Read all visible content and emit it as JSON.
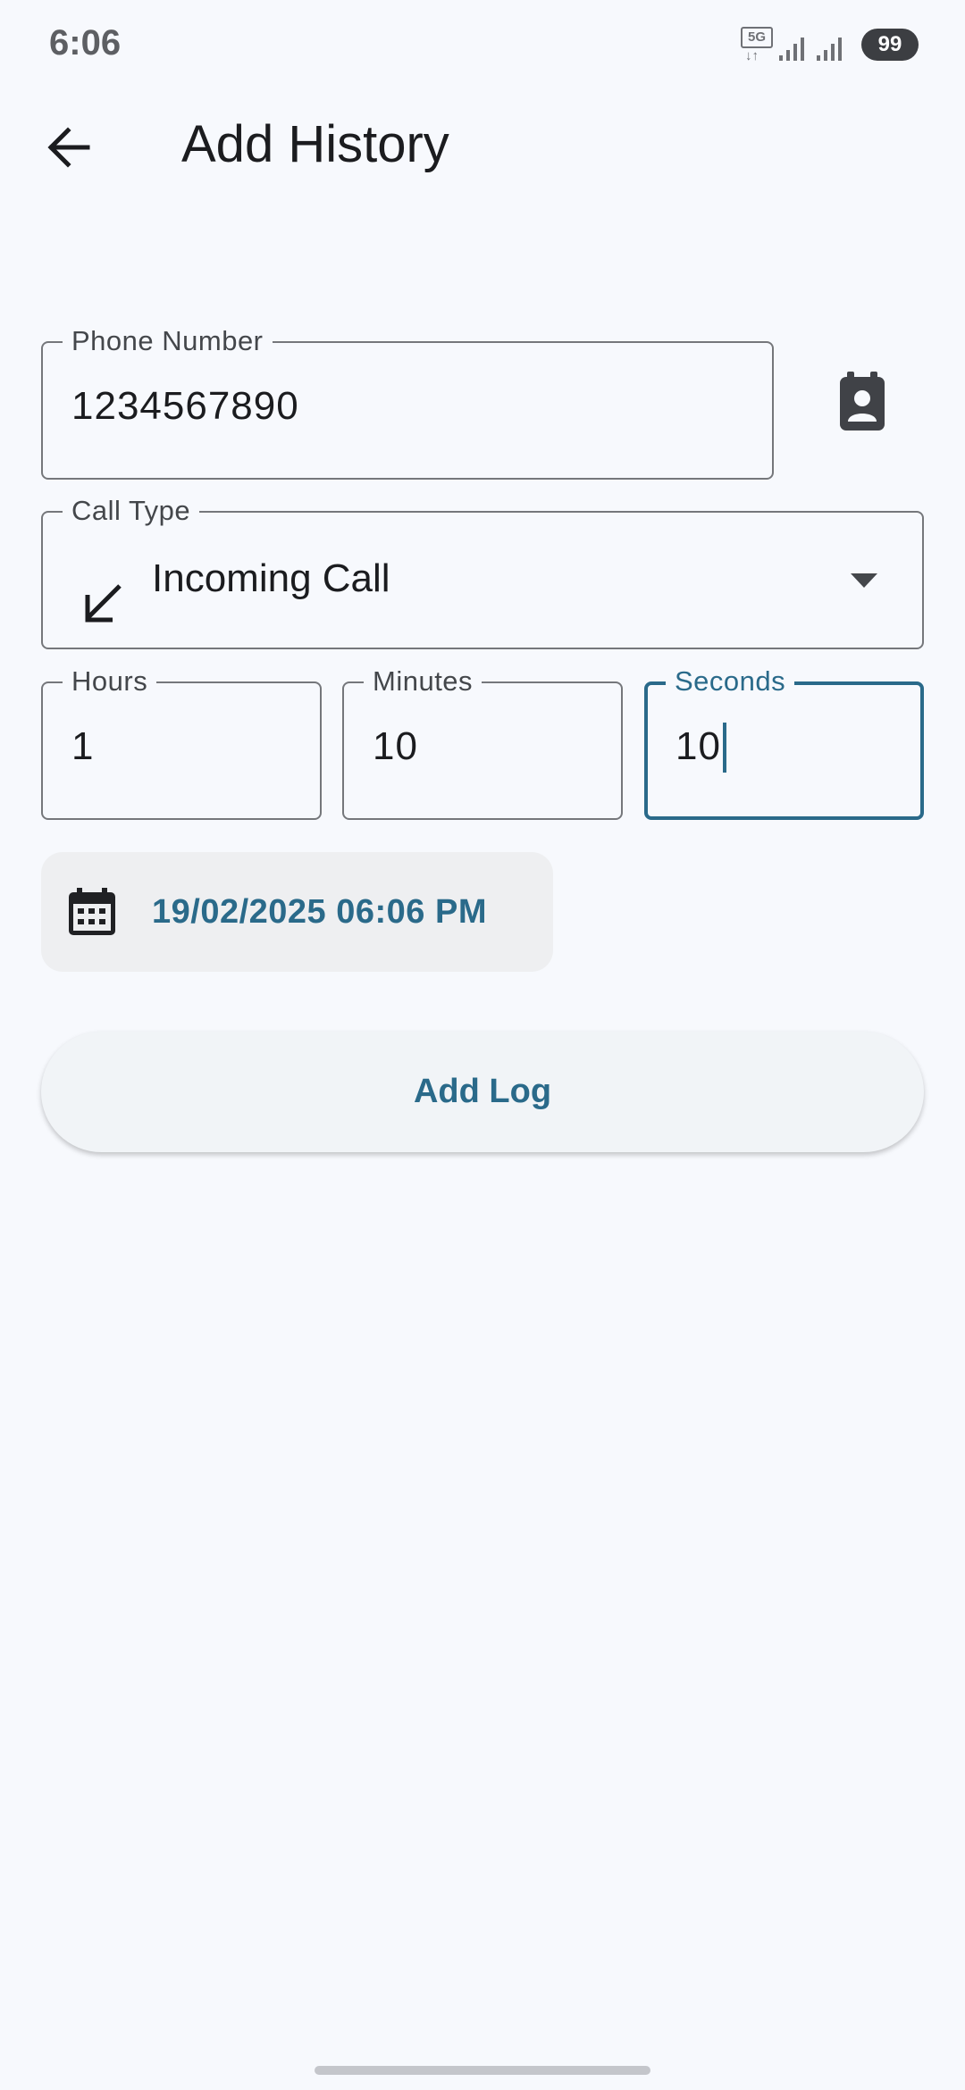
{
  "status_bar": {
    "time": "6:06",
    "network": "5G",
    "battery": "99"
  },
  "app_bar": {
    "title": "Add History",
    "back_icon": "arrow-back-icon"
  },
  "form": {
    "phone": {
      "label": "Phone Number",
      "value": "1234567890"
    },
    "contact_icon": "contact-book-icon",
    "call_type": {
      "label": "Call Type",
      "value": "Incoming Call",
      "icon": "call-received-icon"
    },
    "hours": {
      "label": "Hours",
      "value": "1"
    },
    "minutes": {
      "label": "Minutes",
      "value": "10"
    },
    "seconds": {
      "label": "Seconds",
      "value": "10"
    },
    "datetime": {
      "value": "19/02/2025 06:06 PM",
      "icon": "calendar-icon"
    },
    "submit_label": "Add Log"
  },
  "colors": {
    "accent": "#2a6a8a",
    "background": "#f7f9fd",
    "outline": "#75777b"
  }
}
